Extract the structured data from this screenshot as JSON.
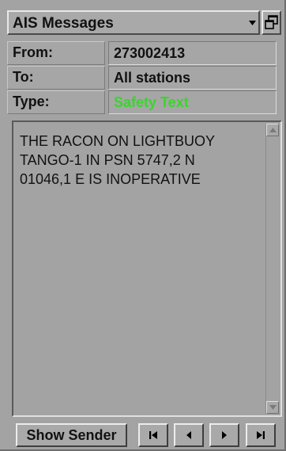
{
  "window": {
    "title": "AIS Messages",
    "dropdown_icon": "triangle-down",
    "window_icon": "restore-window"
  },
  "fields": {
    "from_label": "From:",
    "from_value": "273002413",
    "to_label": "To:",
    "to_value": "All stations",
    "type_label": "Type:",
    "type_value": "Safety Text"
  },
  "message": {
    "text": "THE RACON ON LIGHTBUOY\nTANGO-1 IN PSN 5747,2 N\n01046,1 E IS INOPERATIVE"
  },
  "toolbar": {
    "show_sender_label": "Show Sender",
    "nav_icons": [
      "first-icon",
      "prev-icon",
      "next-icon",
      "last-icon"
    ]
  },
  "colors": {
    "panel": "#a3a3a3",
    "safety_text": "#39d62b"
  }
}
